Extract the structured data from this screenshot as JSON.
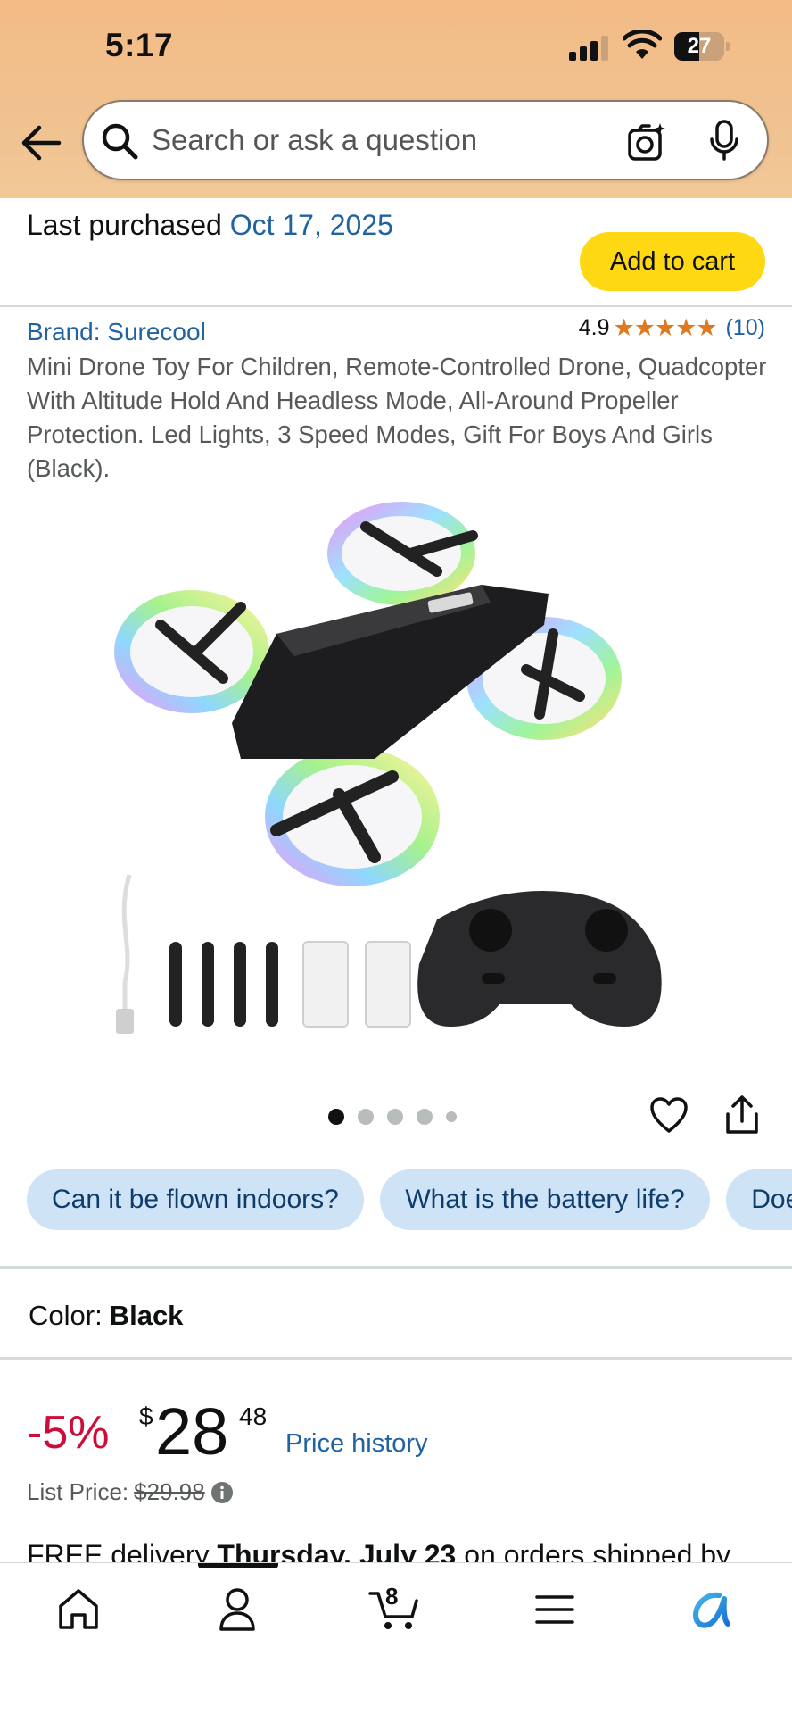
{
  "status_bar": {
    "time": "5:17",
    "battery": "27"
  },
  "search": {
    "placeholder": "Search or ask a question"
  },
  "previous": {
    "price_peek_discount": "-5%",
    "price_peek_value": "$28.48",
    "last_purchased_label": "Last purchased",
    "last_purchased_date": "Oct 17, 2025",
    "add_to_cart_label": "Add to cart"
  },
  "product": {
    "brand": "Brand: Surecool",
    "rating_value": "4.9",
    "stars": "★★★★★",
    "rating_count": "(10)",
    "title": "Mini Drone Toy For Children, Remote-Controlled Drone, Quadcopter With Altitude Hold And Headless Mode, All-Around Propeller Protection. Led Lights, 3 Speed Modes, Gift For Boys And Girls (Black).",
    "image_count": 5,
    "active_image": 1
  },
  "questions": [
    "Can it be flown indoors?",
    "What is the battery life?",
    "Does it"
  ],
  "color": {
    "label": "Color:",
    "value": "Black"
  },
  "price": {
    "discount": "-5%",
    "symbol": "$",
    "whole": "28",
    "fraction": "48",
    "history_link": "Price history",
    "list_label": "List Price:",
    "list_value": "$29.98"
  },
  "delivery": {
    "prefix": "FREE delivery ",
    "day": "Thursday, July 23",
    "suffix": " on orders shipped by"
  },
  "nav": {
    "cart_count": "8",
    "items": [
      "home-icon",
      "account-icon",
      "cart-icon",
      "menu-icon",
      "rufus-icon"
    ]
  },
  "colors": {
    "header_bg": "#f3bb86",
    "link": "#2162a1",
    "discount_red": "#cc0c39",
    "cart_yellow": "#ffd814",
    "star_orange": "#de7921",
    "chip_bg": "#cfe3f7"
  }
}
